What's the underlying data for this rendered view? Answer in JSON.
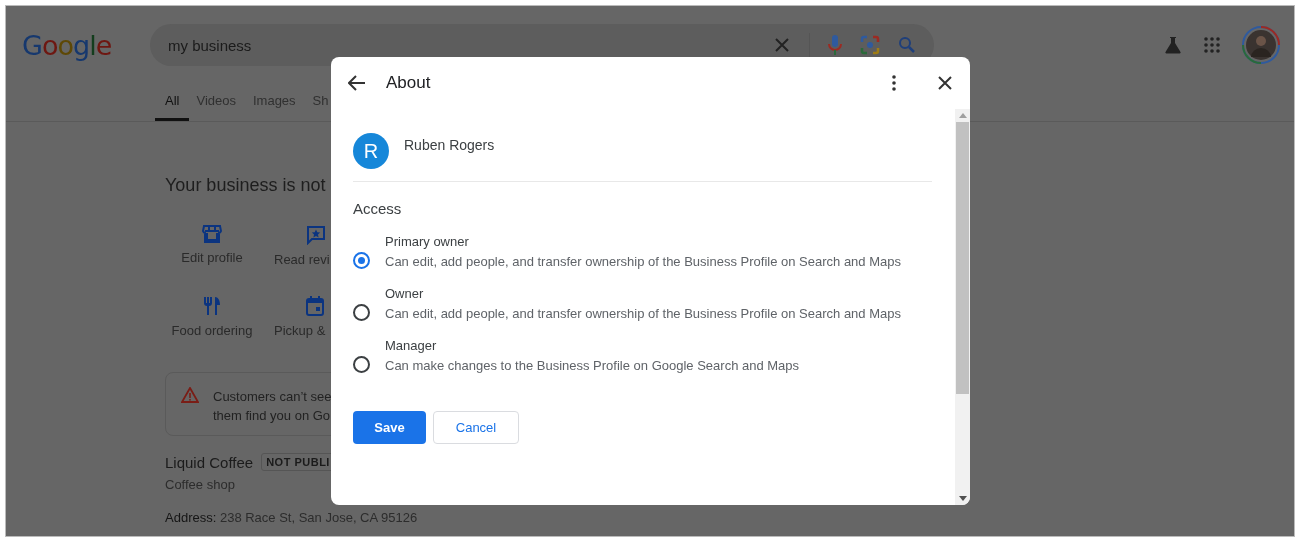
{
  "browser_page": {
    "logo": "Google",
    "search": {
      "value": "my business"
    },
    "tabs": [
      {
        "label": "All",
        "selected": true
      },
      {
        "label": "Videos",
        "selected": false
      },
      {
        "label": "Images",
        "selected": false
      },
      {
        "label": "Sh",
        "selected": false
      }
    ],
    "heading": "Your business is not",
    "actions": [
      {
        "kind": "store",
        "label": "Edit profile"
      },
      {
        "kind": "review",
        "label": "Read revi"
      },
      {
        "kind": "food",
        "label": "Food ordering"
      },
      {
        "kind": "calendar",
        "label": "Pickup &"
      }
    ],
    "warning": {
      "lines": [
        "Customers can’t see",
        "them find you on Go"
      ]
    },
    "business": {
      "name": "Liquid Coffee",
      "badge": "NOT PUBLI",
      "category": "Coffee shop",
      "address": "**Address:** 238 Race St, San Jose, CA 95126"
    }
  },
  "dialog": {
    "title": "About",
    "user": {
      "initial": "R",
      "name": "Ruben Rogers"
    },
    "section": "Access",
    "roles": [
      {
        "name": "Primary owner",
        "description": "Can edit, add people, and transfer ownership of the Business Profile on Search and Maps",
        "selected": true
      },
      {
        "name": "Owner",
        "description": "Can edit, add people, and transfer ownership of the Business Profile on Search and Maps",
        "selected": false
      },
      {
        "name": "Manager",
        "description": "Can make changes to the Business Profile on Google Search and Maps",
        "selected": false
      }
    ],
    "buttons": [
      {
        "kind": "primary",
        "label": "Save"
      },
      {
        "kind": "secondary",
        "label": "Cancel"
      }
    ]
  }
}
